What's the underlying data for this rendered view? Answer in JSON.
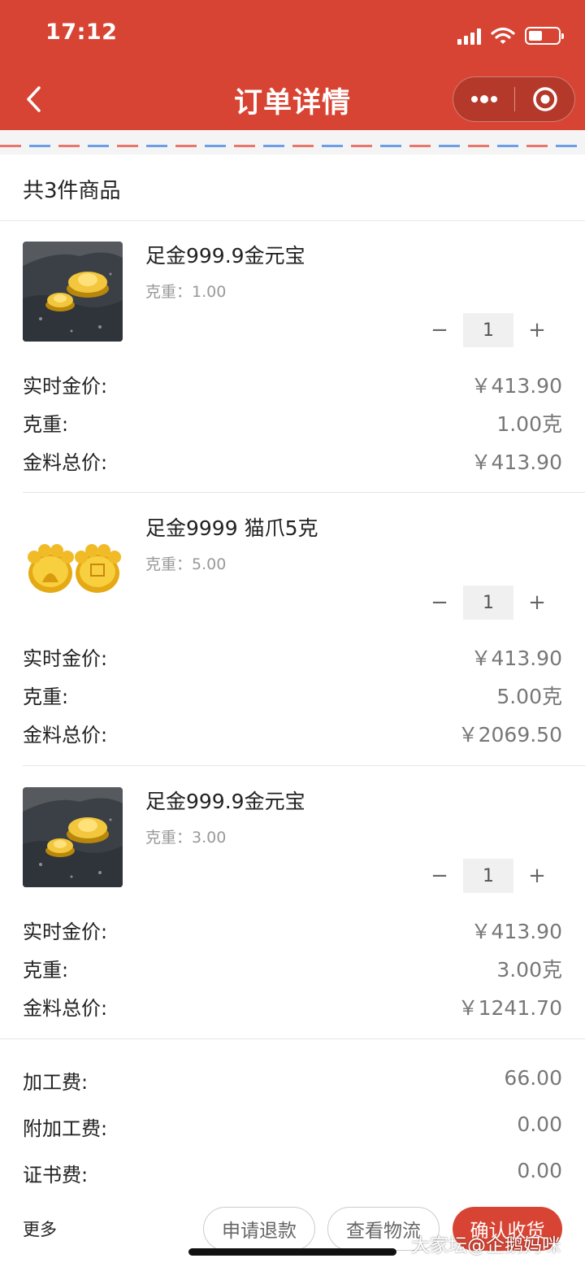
{
  "status_bar": {
    "time": "17:12"
  },
  "header": {
    "title": "订单详情"
  },
  "summary": {
    "count_text": "共3件商品"
  },
  "items": [
    {
      "name": "足金999.9金元宝",
      "weight_text": "克重：1.00",
      "thumb": "gold-ingot-photo",
      "quantity": "1",
      "price_label": "实时金价:",
      "price": "￥413.90",
      "weight_label": "克重:",
      "weight": "1.00克",
      "total_label": "金料总价:",
      "total": "￥413.90"
    },
    {
      "name": "足金9999 猫爪5克",
      "weight_text": "克重：5.00",
      "thumb": "gold-paw-photo",
      "quantity": "1",
      "price_label": "实时金价:",
      "price": "￥413.90",
      "weight_label": "克重:",
      "weight": "5.00克",
      "total_label": "金料总价:",
      "total": "￥2069.50"
    },
    {
      "name": "足金999.9金元宝",
      "weight_text": "克重：3.00",
      "thumb": "gold-ingot-photo",
      "quantity": "1",
      "price_label": "实时金价:",
      "price": "￥413.90",
      "weight_label": "克重:",
      "weight": "3.00克",
      "total_label": "金料总价:",
      "total": "￥1241.70"
    }
  ],
  "stepper": {
    "minus": "−",
    "plus": "+"
  },
  "fees": [
    {
      "label": "加工费:",
      "value": "66.00"
    },
    {
      "label": "附加工费:",
      "value": "0.00"
    },
    {
      "label": "证书费:",
      "value": "0.00"
    }
  ],
  "actions": {
    "more": "更多",
    "refund": "申请退款",
    "logistics": "查看物流",
    "confirm": "确认收货"
  },
  "watermark": "大家坛@企鹅妈咪",
  "colors": {
    "brand": "#d84433",
    "muted": "#777777",
    "stripe_red": "#e9766a",
    "stripe_blue": "#6e9fe6"
  }
}
